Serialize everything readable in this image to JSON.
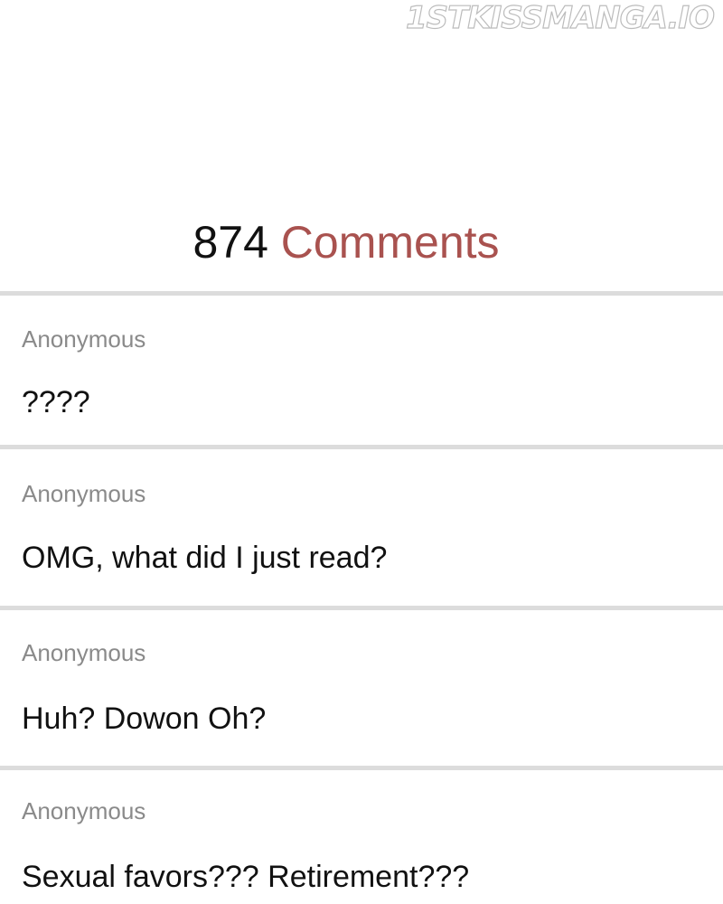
{
  "watermark": "1STKISSMANGA.IO",
  "header": {
    "count": "874",
    "label": "Comments"
  },
  "comments": [
    {
      "author": "Anonymous",
      "text": "????"
    },
    {
      "author": "Anonymous",
      "text": "OMG, what did I just read?"
    },
    {
      "author": "Anonymous",
      "text": "Huh? Dowon Oh?"
    },
    {
      "author": "Anonymous",
      "text": "Sexual favors??? Retirement???"
    }
  ],
  "colors": {
    "accent": "#a9524f",
    "divider": "#dcdcdc",
    "author": "#8a8a8a"
  }
}
